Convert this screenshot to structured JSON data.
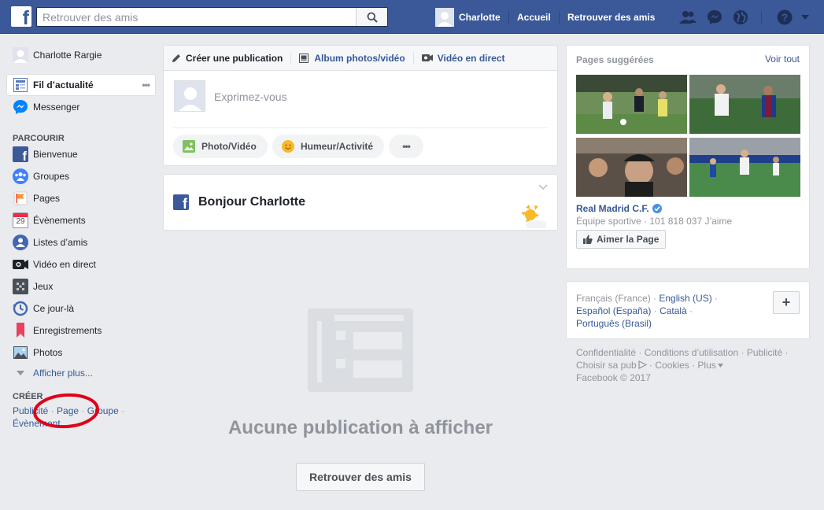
{
  "topbar": {
    "logo": "f",
    "search_placeholder": "Retrouver des amis",
    "user_name": "Charlotte",
    "home_label": "Accueil",
    "find_friends_label": "Retrouver des amis"
  },
  "leftnav": {
    "profile_name": "Charlotte Rargie",
    "news_feed_label": "Fil d’actualité",
    "news_feed_more": "•••",
    "messenger_label": "Messenger",
    "explore_heading": "PARCOURIR",
    "items": [
      {
        "label": "Bienvenue",
        "icon": "facebook-f-icon"
      },
      {
        "label": "Groupes",
        "icon": "groups-icon"
      },
      {
        "label": "Pages",
        "icon": "flag-icon"
      },
      {
        "label": "Évènements",
        "icon": "calendar-icon"
      },
      {
        "label": "Listes d’amis",
        "icon": "friend-lists-icon"
      },
      {
        "label": "Vidéo en direct",
        "icon": "live-video-icon"
      },
      {
        "label": "Jeux",
        "icon": "games-icon"
      },
      {
        "label": "Ce jour-là",
        "icon": "on-this-day-icon"
      },
      {
        "label": "Enregistrements",
        "icon": "saved-bookmark-icon"
      },
      {
        "label": "Photos",
        "icon": "photos-icon"
      }
    ],
    "calendar_day": "29",
    "see_more_label": "Afficher plus...",
    "create_heading": "CRÉER",
    "create_links": {
      "ad": "Publicité",
      "page": "Page",
      "group": "Groupe",
      "event": "Évènement"
    },
    "separator": "·"
  },
  "composer": {
    "tab_create": "Créer une publication",
    "tab_album": "Album photos/vidéo",
    "tab_live": "Vidéo en direct",
    "input_placeholder": "Exprimez-vous",
    "photo_video_label": "Photo/Vidéo",
    "mood_label": "Humeur/Activité",
    "more_label": "•••"
  },
  "greeting": {
    "text": "Bonjour Charlotte"
  },
  "feed": {
    "empty_title": "Aucune publication à afficher",
    "find_friends_button": "Retrouver des amis"
  },
  "suggested_pages": {
    "heading": "Pages suggérées",
    "see_all": "Voir tout",
    "page_name": "Real Madrid C.F.",
    "page_meta": "Équipe sportive · 101 818 037 J’aime",
    "like_button": "Aimer la Page"
  },
  "languages": {
    "current": "Français (France)",
    "options": [
      "English (US)",
      "Español (España)",
      "Català",
      "Português (Brasil)"
    ],
    "add_label": "+"
  },
  "footer": {
    "privacy": "Confidentialité",
    "terms": "Conditions d’utilisation",
    "advertising": "Publicité",
    "ad_choices": "Choisir sa pub",
    "cookies": "Cookies",
    "more": "Plus",
    "copyright": "Facebook © 2017"
  },
  "colors": {
    "brand": "#3b5998",
    "link": "#365899",
    "background": "#e9ebee",
    "annotation": "#e0001a"
  }
}
